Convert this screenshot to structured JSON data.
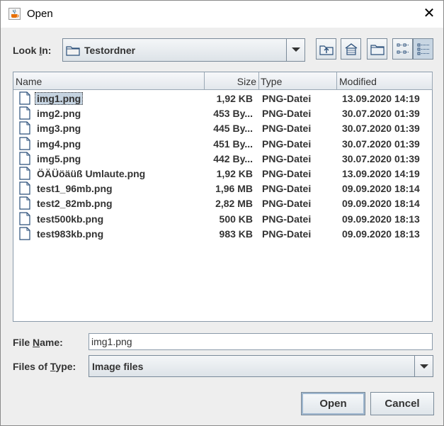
{
  "window": {
    "title": "Open"
  },
  "look_in": {
    "label_pre": "Look ",
    "label_mnemonic": "I",
    "label_post": "n:",
    "value": "Testordner"
  },
  "columns": {
    "name": "Name",
    "size": "Size",
    "type": "Type",
    "modified": "Modified"
  },
  "files": [
    {
      "name": "img1.png",
      "size": "1,92 KB",
      "type": "PNG-Datei",
      "modified": "13.09.2020 14:19",
      "selected": true
    },
    {
      "name": "img2.png",
      "size": "453 By...",
      "type": "PNG-Datei",
      "modified": "30.07.2020 01:39"
    },
    {
      "name": "img3.png",
      "size": "445 By...",
      "type": "PNG-Datei",
      "modified": "30.07.2020 01:39"
    },
    {
      "name": "img4.png",
      "size": "451 By...",
      "type": "PNG-Datei",
      "modified": "30.07.2020 01:39"
    },
    {
      "name": "img5.png",
      "size": "442 By...",
      "type": "PNG-Datei",
      "modified": "30.07.2020 01:39"
    },
    {
      "name": "ÖÄÜöäüß Umlaute.png",
      "size": "1,92 KB",
      "type": "PNG-Datei",
      "modified": "13.09.2020 14:19"
    },
    {
      "name": "test1_96mb.png",
      "size": "1,96 MB",
      "type": "PNG-Datei",
      "modified": "09.09.2020 18:14"
    },
    {
      "name": "test2_82mb.png",
      "size": "2,82 MB",
      "type": "PNG-Datei",
      "modified": "09.09.2020 18:14"
    },
    {
      "name": "test500kb.png",
      "size": "500 KB",
      "type": "PNG-Datei",
      "modified": "09.09.2020 18:13"
    },
    {
      "name": "test983kb.png",
      "size": "983 KB",
      "type": "PNG-Datei",
      "modified": "09.09.2020 18:13"
    }
  ],
  "file_name": {
    "label_pre": "File ",
    "label_mnemonic": "N",
    "label_post": "ame:",
    "value": "img1.png"
  },
  "file_type": {
    "label_pre": "Files of ",
    "label_mnemonic": "T",
    "label_post": "ype:",
    "value": "Image files"
  },
  "buttons": {
    "open": "Open",
    "cancel": "Cancel"
  },
  "icons": {
    "app": "java-cup-icon",
    "close": "close-icon",
    "folder": "folder-icon",
    "up": "up-one-level-icon",
    "home": "home-icon",
    "new_folder": "new-folder-icon",
    "list_view": "list-view-icon",
    "details_view": "details-view-icon",
    "file": "file-icon"
  },
  "colors": {
    "selection": "#c5d3e0",
    "dialog_bg": "#eeeeee",
    "text": "#333333"
  }
}
